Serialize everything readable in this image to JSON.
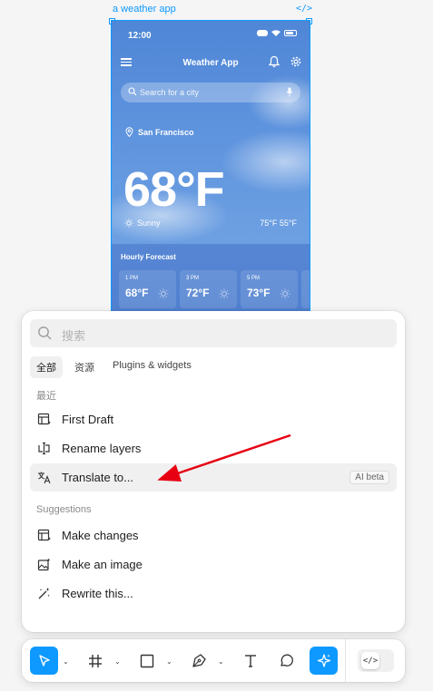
{
  "canvas": {
    "frame_label": "a weather app",
    "code_glyph": "</>"
  },
  "weather_app": {
    "status_time": "12:00",
    "title": "Weather App",
    "search_placeholder": "Search for a city",
    "location": "San Francisco",
    "temperature": "68°F",
    "condition": "Sunny",
    "high_low": "75°F  55°F",
    "hourly_title": "Hourly Forecast",
    "hourly": [
      {
        "time": "1 PM",
        "temp": "68°F"
      },
      {
        "time": "3 PM",
        "temp": "72°F"
      },
      {
        "time": "5 PM",
        "temp": "73°F"
      }
    ]
  },
  "quick_actions": {
    "search_placeholder": "搜索",
    "tabs": [
      {
        "label": "全部",
        "active": true
      },
      {
        "label": "资源",
        "active": false
      },
      {
        "label": "Plugins & widgets",
        "active": false
      }
    ],
    "recent_label": "最近",
    "recent": [
      {
        "label": "First Draft",
        "icon": "frame-template-icon"
      },
      {
        "label": "Rename layers",
        "icon": "rename-layers-icon"
      },
      {
        "label": "Translate to...",
        "icon": "translate-icon",
        "badge": "AI beta",
        "hovered": true
      }
    ],
    "suggestions_label": "Suggestions",
    "suggestions": [
      {
        "label": "Make changes",
        "icon": "frame-template-icon"
      },
      {
        "label": "Make an image",
        "icon": "image-sparkle-icon"
      },
      {
        "label": "Rewrite this...",
        "icon": "magic-wand-icon"
      }
    ]
  },
  "toolbar": {
    "tools": [
      "move-tool",
      "frame-tool",
      "shape-tool",
      "pen-tool",
      "text-tool",
      "comment-tool",
      "actions-tool"
    ],
    "dev_mode_glyph": "</>"
  },
  "colors": {
    "accent": "#0d99ff",
    "annotation_arrow": "#e60012",
    "sky_top": "#4f86d6",
    "sky_bottom": "#6da0e2"
  }
}
